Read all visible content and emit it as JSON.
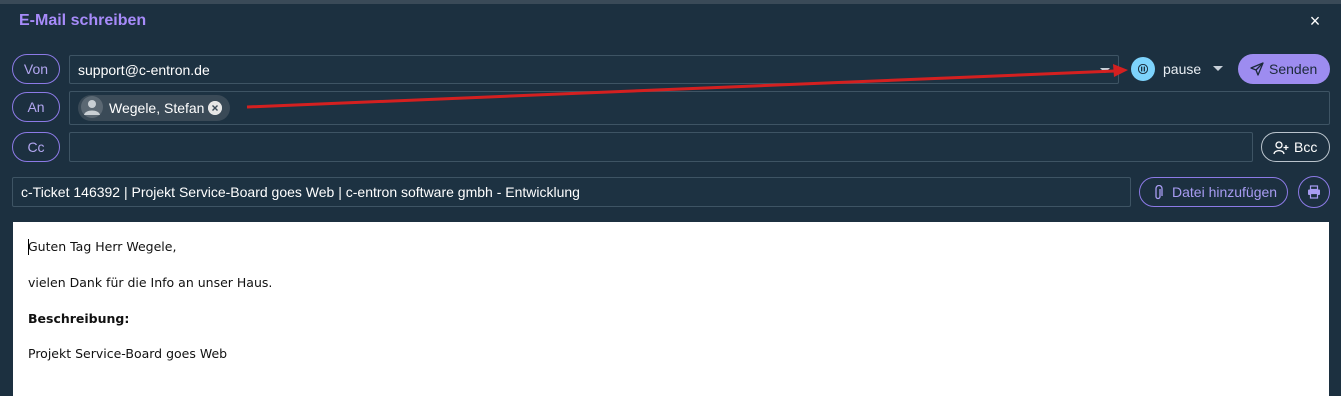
{
  "dialog": {
    "title": "E-Mail schreiben",
    "close_symbol": "×"
  },
  "from": {
    "label": "Von",
    "value": "support@c-entron.de"
  },
  "to": {
    "label": "An",
    "recipients": [
      {
        "name": "Wegele, Stefan"
      }
    ]
  },
  "cc": {
    "label": "Cc",
    "value": ""
  },
  "bcc_button": {
    "label": "Bcc"
  },
  "status": {
    "value": "pause"
  },
  "send_button": {
    "label": "Senden"
  },
  "subject": {
    "value": "c-Ticket 146392 | Projekt Service-Board goes Web | c-entron software gmbh - Entwicklung"
  },
  "attach_button": {
    "label": "Datei hinzufügen"
  },
  "body": {
    "greeting": "Guten Tag Herr Wegele,",
    "line1": "vielen Dank für die Info an unser Haus.",
    "heading": "Beschreibung:",
    "line2": "Projekt Service-Board goes Web"
  },
  "colors": {
    "background": "#1c3040",
    "accent": "#9d8cf0",
    "title": "#a78bfa",
    "status_dot": "#7dd3fc",
    "annotation_arrow": "#d42020"
  },
  "icons": {
    "status": "pause-icon",
    "send": "paper-plane-icon",
    "recipient": "user-avatar-icon",
    "bcc": "user-plus-icon",
    "attach": "paperclip-icon",
    "print": "printer-icon",
    "close": "close-icon"
  }
}
